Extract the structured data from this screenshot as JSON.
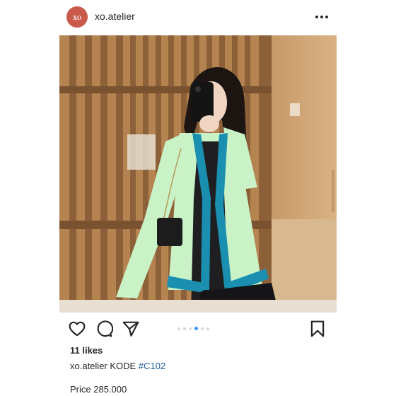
{
  "header": {
    "avatar_text": "xo",
    "username": "xo.atelier",
    "more_icon": "more-horizontal-icon"
  },
  "photo": {
    "description_icon": "post-photo",
    "colors": {
      "cardigan": "#c9f2c7",
      "trim": "#1a8fb0",
      "wood": "#a8794c"
    }
  },
  "actions": {
    "like_icon": "heart-icon",
    "comment_icon": "comment-icon",
    "share_icon": "paper-plane-icon",
    "save_icon": "bookmark-icon",
    "carousel": {
      "count": 6,
      "active_index": 3
    }
  },
  "likes": "11 likes",
  "caption": {
    "username": "xo.atelier",
    "text": "KODE",
    "hashtag": "#C102"
  },
  "price": "Price 285.000"
}
